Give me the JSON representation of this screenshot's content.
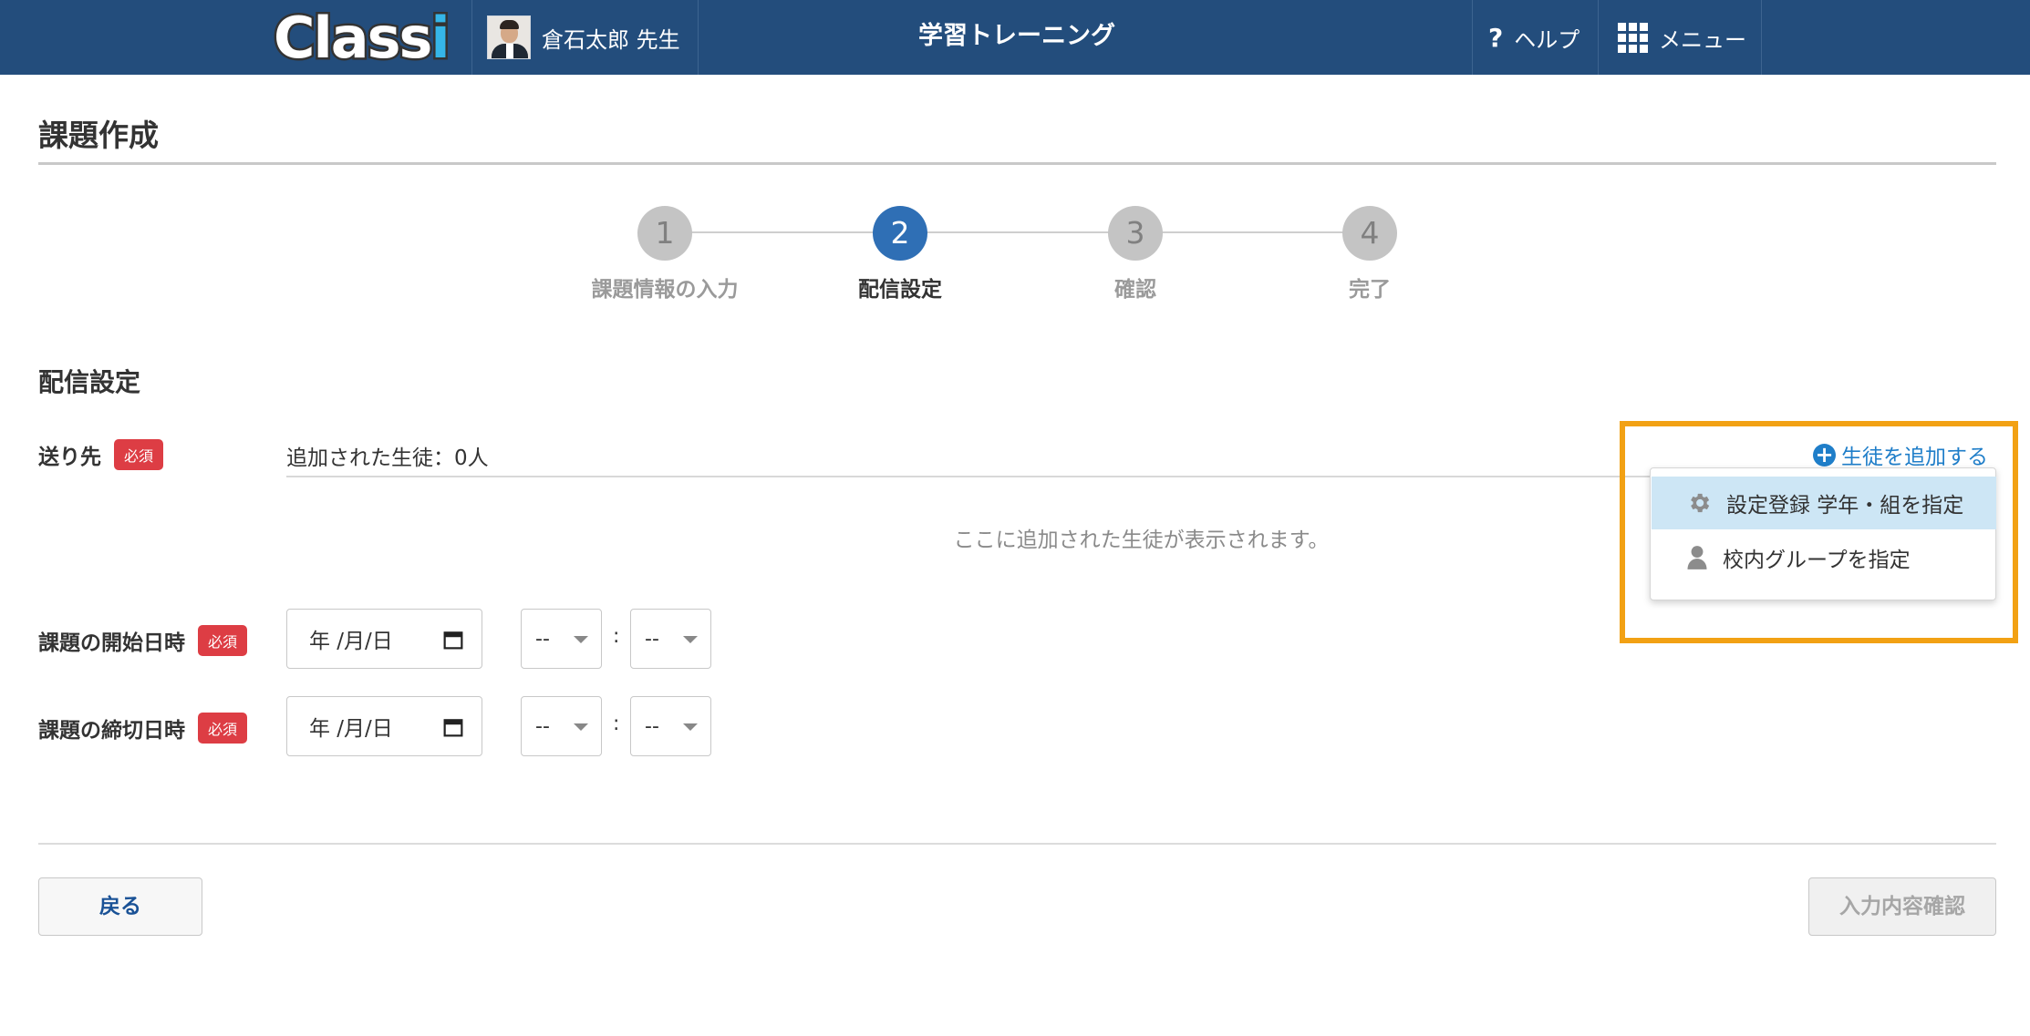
{
  "header": {
    "logo": "Classi",
    "user_name": "倉石太郎 先生",
    "app_title": "学習トレーニング",
    "help": {
      "icon": "question-icon",
      "label": "ヘルプ"
    },
    "menu": {
      "icon": "grid-icon",
      "label": "メニュー"
    },
    "background_color": "#234d7c"
  },
  "page": {
    "title": "課題作成"
  },
  "stepper": {
    "current": 2,
    "active_color": "#2f6fb5",
    "steps": [
      {
        "number": "1",
        "label": "課題情報の入力"
      },
      {
        "number": "2",
        "label": "配信設定"
      },
      {
        "number": "3",
        "label": "確認"
      },
      {
        "number": "4",
        "label": "完了"
      }
    ]
  },
  "section": {
    "title": "配信設定"
  },
  "recipients": {
    "label": "送り先",
    "required": "必須",
    "added_count": "追加された生徒：0人",
    "empty_message": "ここに追加された生徒が表示されます。",
    "add_link": {
      "icon": "plus-circle-icon",
      "label": "生徒を追加する"
    },
    "dropdown": [
      {
        "icon": "gear-icon",
        "label": "設定登録 学年・組を指定",
        "highlighted": true
      },
      {
        "icon": "person-icon",
        "label": "校内グループを指定",
        "highlighted": false
      }
    ],
    "highlight_color": "#f2a114"
  },
  "start": {
    "label": "課題の開始日時",
    "required": "必須",
    "date_placeholder": "年 /月/日",
    "hour": "--",
    "separator": ":",
    "minute": "--"
  },
  "end": {
    "label": "課題の締切日時",
    "required": "必須",
    "date_placeholder": "年 /月/日",
    "hour": "--",
    "separator": ":",
    "minute": "--"
  },
  "footer": {
    "back_label": "戻る",
    "confirm_label": "入力内容確認"
  }
}
